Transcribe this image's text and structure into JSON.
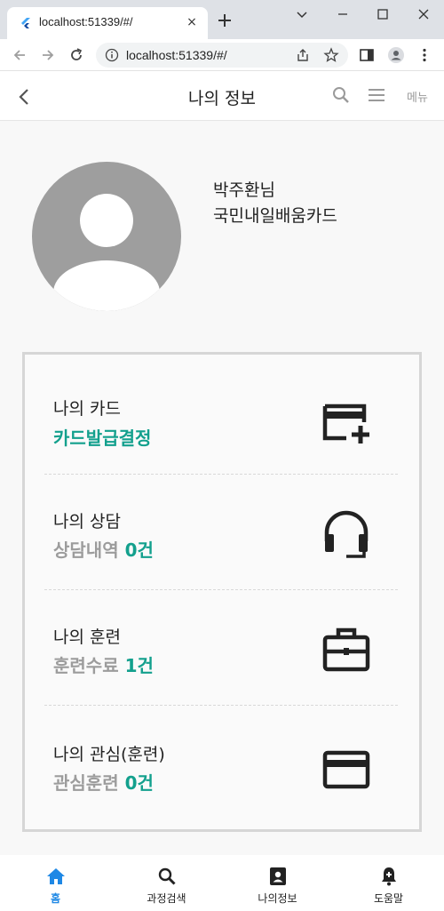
{
  "browser": {
    "tab_title": "localhost:51339/#/",
    "url": "localhost:51339/#/",
    "tab_close": "×"
  },
  "appbar": {
    "title": "나의 정보",
    "menu_label": "메뉴"
  },
  "profile": {
    "name": "박주환님",
    "card_type": "국민내일배움카드"
  },
  "items": [
    {
      "title": "나의 카드",
      "sub_prefix": "",
      "sub_value": "카드발급결정",
      "icon": "card-add-icon"
    },
    {
      "title": "나의 상담",
      "sub_prefix": "상담내역 ",
      "sub_value": "0건",
      "icon": "headset-icon"
    },
    {
      "title": "나의 훈련",
      "sub_prefix": "훈련수료 ",
      "sub_value": "1건",
      "icon": "briefcase-icon"
    },
    {
      "title": "나의 관심(훈련)",
      "sub_prefix": "관심훈련 ",
      "sub_value": "0건",
      "icon": "credit-card-icon"
    }
  ],
  "bottom_nav": [
    {
      "label": "홈",
      "icon": "home-icon",
      "active": true
    },
    {
      "label": "과정검색",
      "icon": "search-icon",
      "active": false
    },
    {
      "label": "나의정보",
      "icon": "contact-card-icon",
      "active": false
    },
    {
      "label": "도움말",
      "icon": "bell-plus-icon",
      "active": false
    }
  ],
  "colors": {
    "accent": "#13a08d",
    "active_nav": "#1e88e5",
    "muted": "#9c9c9c"
  }
}
